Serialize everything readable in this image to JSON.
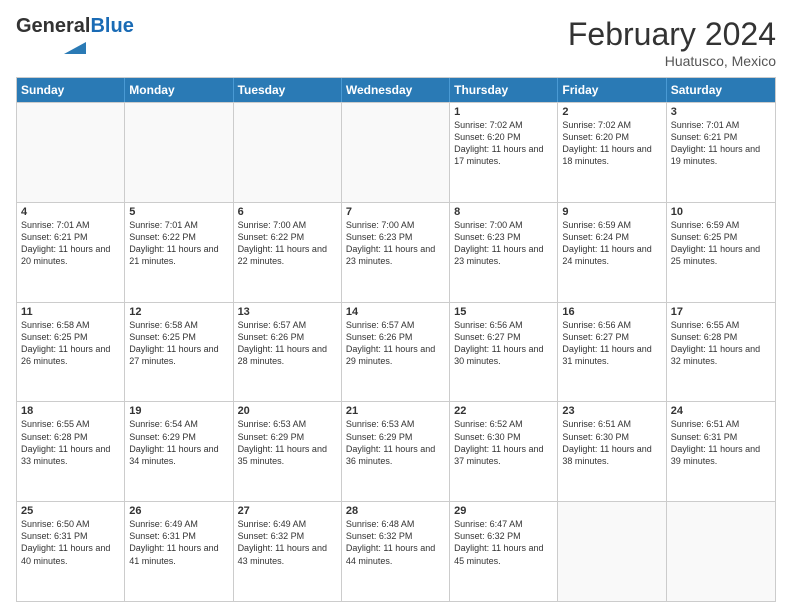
{
  "logo": {
    "general": "General",
    "blue": "Blue"
  },
  "title": "February 2024",
  "subtitle": "Huatusco, Mexico",
  "headers": [
    "Sunday",
    "Monday",
    "Tuesday",
    "Wednesday",
    "Thursday",
    "Friday",
    "Saturday"
  ],
  "weeks": [
    [
      {
        "day": "",
        "info": ""
      },
      {
        "day": "",
        "info": ""
      },
      {
        "day": "",
        "info": ""
      },
      {
        "day": "",
        "info": ""
      },
      {
        "day": "1",
        "info": "Sunrise: 7:02 AM\nSunset: 6:20 PM\nDaylight: 11 hours and 17 minutes."
      },
      {
        "day": "2",
        "info": "Sunrise: 7:02 AM\nSunset: 6:20 PM\nDaylight: 11 hours and 18 minutes."
      },
      {
        "day": "3",
        "info": "Sunrise: 7:01 AM\nSunset: 6:21 PM\nDaylight: 11 hours and 19 minutes."
      }
    ],
    [
      {
        "day": "4",
        "info": "Sunrise: 7:01 AM\nSunset: 6:21 PM\nDaylight: 11 hours and 20 minutes."
      },
      {
        "day": "5",
        "info": "Sunrise: 7:01 AM\nSunset: 6:22 PM\nDaylight: 11 hours and 21 minutes."
      },
      {
        "day": "6",
        "info": "Sunrise: 7:00 AM\nSunset: 6:22 PM\nDaylight: 11 hours and 22 minutes."
      },
      {
        "day": "7",
        "info": "Sunrise: 7:00 AM\nSunset: 6:23 PM\nDaylight: 11 hours and 23 minutes."
      },
      {
        "day": "8",
        "info": "Sunrise: 7:00 AM\nSunset: 6:23 PM\nDaylight: 11 hours and 23 minutes."
      },
      {
        "day": "9",
        "info": "Sunrise: 6:59 AM\nSunset: 6:24 PM\nDaylight: 11 hours and 24 minutes."
      },
      {
        "day": "10",
        "info": "Sunrise: 6:59 AM\nSunset: 6:25 PM\nDaylight: 11 hours and 25 minutes."
      }
    ],
    [
      {
        "day": "11",
        "info": "Sunrise: 6:58 AM\nSunset: 6:25 PM\nDaylight: 11 hours and 26 minutes."
      },
      {
        "day": "12",
        "info": "Sunrise: 6:58 AM\nSunset: 6:25 PM\nDaylight: 11 hours and 27 minutes."
      },
      {
        "day": "13",
        "info": "Sunrise: 6:57 AM\nSunset: 6:26 PM\nDaylight: 11 hours and 28 minutes."
      },
      {
        "day": "14",
        "info": "Sunrise: 6:57 AM\nSunset: 6:26 PM\nDaylight: 11 hours and 29 minutes."
      },
      {
        "day": "15",
        "info": "Sunrise: 6:56 AM\nSunset: 6:27 PM\nDaylight: 11 hours and 30 minutes."
      },
      {
        "day": "16",
        "info": "Sunrise: 6:56 AM\nSunset: 6:27 PM\nDaylight: 11 hours and 31 minutes."
      },
      {
        "day": "17",
        "info": "Sunrise: 6:55 AM\nSunset: 6:28 PM\nDaylight: 11 hours and 32 minutes."
      }
    ],
    [
      {
        "day": "18",
        "info": "Sunrise: 6:55 AM\nSunset: 6:28 PM\nDaylight: 11 hours and 33 minutes."
      },
      {
        "day": "19",
        "info": "Sunrise: 6:54 AM\nSunset: 6:29 PM\nDaylight: 11 hours and 34 minutes."
      },
      {
        "day": "20",
        "info": "Sunrise: 6:53 AM\nSunset: 6:29 PM\nDaylight: 11 hours and 35 minutes."
      },
      {
        "day": "21",
        "info": "Sunrise: 6:53 AM\nSunset: 6:29 PM\nDaylight: 11 hours and 36 minutes."
      },
      {
        "day": "22",
        "info": "Sunrise: 6:52 AM\nSunset: 6:30 PM\nDaylight: 11 hours and 37 minutes."
      },
      {
        "day": "23",
        "info": "Sunrise: 6:51 AM\nSunset: 6:30 PM\nDaylight: 11 hours and 38 minutes."
      },
      {
        "day": "24",
        "info": "Sunrise: 6:51 AM\nSunset: 6:31 PM\nDaylight: 11 hours and 39 minutes."
      }
    ],
    [
      {
        "day": "25",
        "info": "Sunrise: 6:50 AM\nSunset: 6:31 PM\nDaylight: 11 hours and 40 minutes."
      },
      {
        "day": "26",
        "info": "Sunrise: 6:49 AM\nSunset: 6:31 PM\nDaylight: 11 hours and 41 minutes."
      },
      {
        "day": "27",
        "info": "Sunrise: 6:49 AM\nSunset: 6:32 PM\nDaylight: 11 hours and 43 minutes."
      },
      {
        "day": "28",
        "info": "Sunrise: 6:48 AM\nSunset: 6:32 PM\nDaylight: 11 hours and 44 minutes."
      },
      {
        "day": "29",
        "info": "Sunrise: 6:47 AM\nSunset: 6:32 PM\nDaylight: 11 hours and 45 minutes."
      },
      {
        "day": "",
        "info": ""
      },
      {
        "day": "",
        "info": ""
      }
    ]
  ]
}
